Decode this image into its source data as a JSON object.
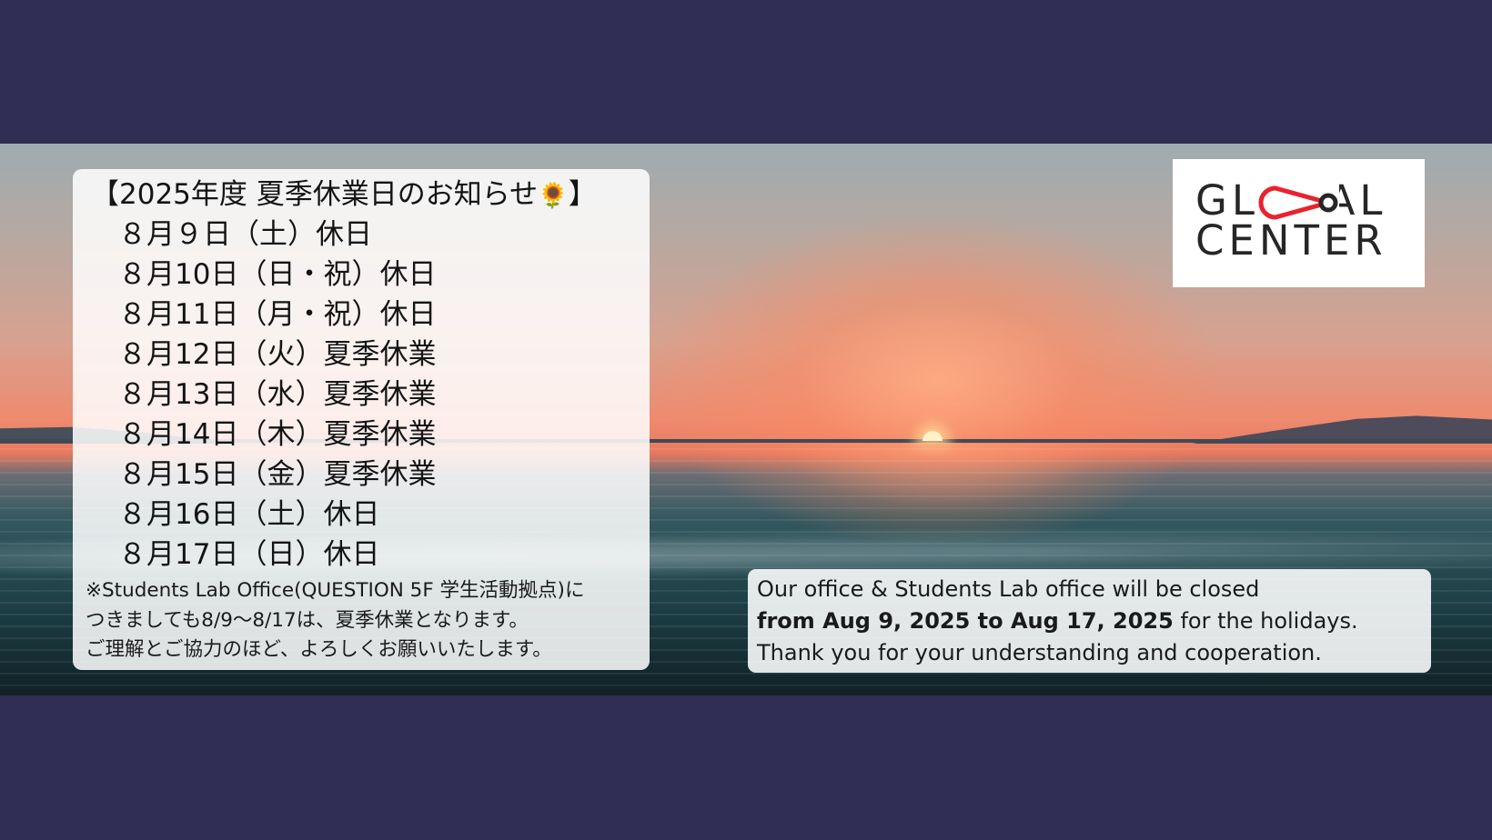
{
  "announcement": {
    "title_open": "【2025年度 夏季休業日のお知らせ",
    "title_emoji": "🌻",
    "title_close": "】",
    "dates": [
      "８月９日（土）休日",
      "８月10日（日・祝）休日",
      "８月11日（月・祝）休日",
      "８月12日（火）夏季休業",
      "８月13日（水）夏季休業",
      "８月14日（木）夏季休業",
      "８月15日（金）夏季休業",
      "８月16日（土）休日",
      "８月17日（日）休日"
    ],
    "note_line1": "※Students Lab Office(QUESTION 5F 学生活動拠点)に",
    "note_line2": "つきましても8/9〜8/17は、夏季休業となります。",
    "note_line3": "ご理解とご協力のほど、よろしくお願いいたします。"
  },
  "logo": {
    "line1": "GLOBAL",
    "line2": "CENTER",
    "accent_color": "#e8232f",
    "text_color": "#262626"
  },
  "english_notice": {
    "line1": "Our office & Students Lab office will be closed",
    "line2_bold": "from Aug 9, 2025 to Aug 17, 2025",
    "line2_rest": " for the  holidays.",
    "line3": "Thank you for your understanding and cooperation."
  },
  "colors": {
    "background": "#302e54",
    "panel": "#ffffff"
  }
}
